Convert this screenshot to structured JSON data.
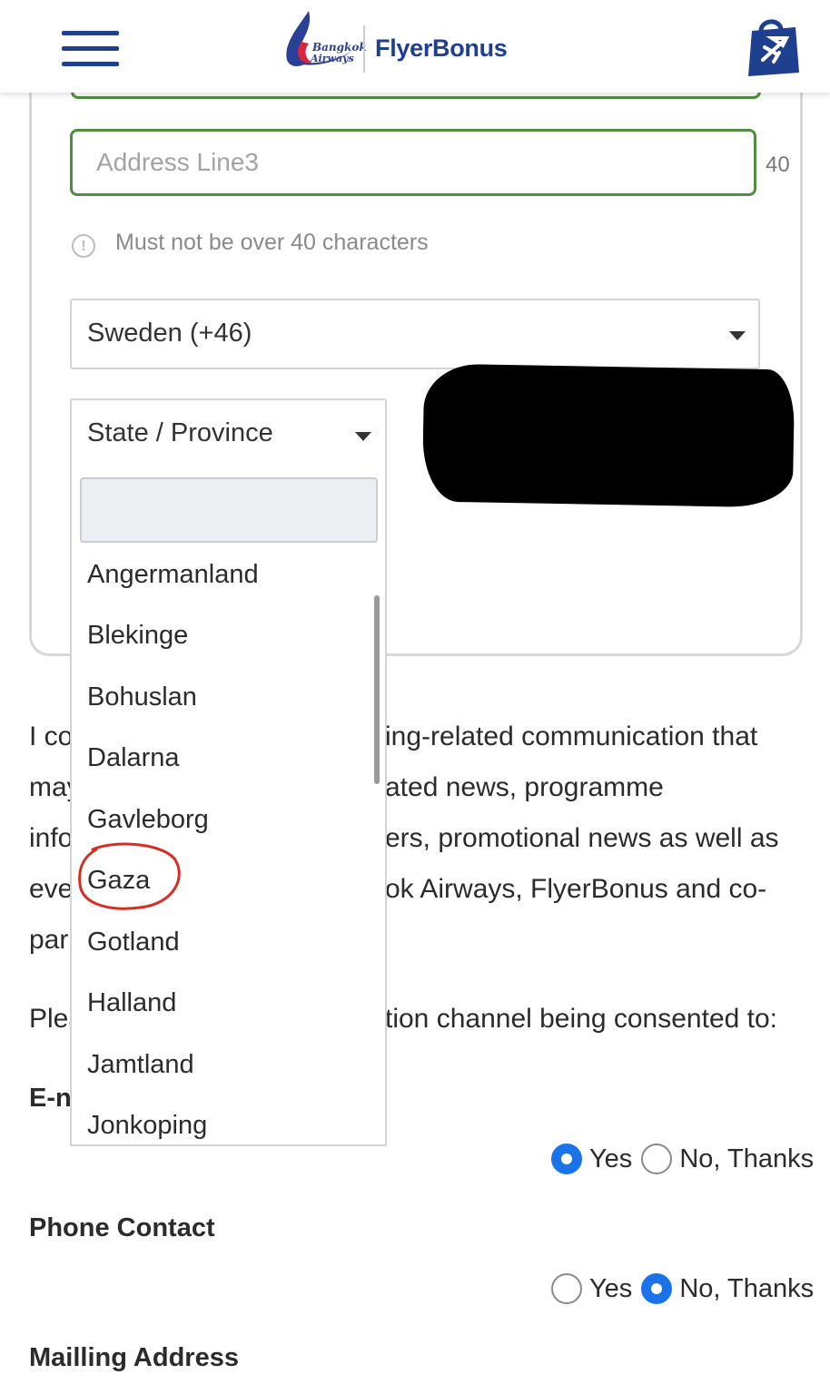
{
  "header": {
    "logo_small_1": "Bangkok",
    "logo_small_2": "Airways",
    "logo_brand": "FlyerBonus"
  },
  "form": {
    "address_line3_placeholder": "Address Line3",
    "address_line3_counter": "40",
    "hint": "Must not be over 40 characters",
    "country_value": "Sweden (+46)",
    "state_placeholder": "State / Province"
  },
  "dropdown": {
    "items": [
      "Angermanland",
      "Blekinge",
      "Bohuslan",
      "Dalarna",
      "Gavleborg",
      "Gaza",
      "Gotland",
      "Halland",
      "Jamtland",
      "Jonkoping"
    ],
    "highlighted_item": "Gaza",
    "highlight_color": "#d92b22"
  },
  "consent": {
    "lines": [
      {
        "left": "I co",
        "right": "ing-related communication that"
      },
      {
        "left": "may",
        "right": "ated news, programme"
      },
      {
        "left": "info",
        "right": "ers, promotional news as well as"
      },
      {
        "left": "eve",
        "right": "ok Airways, FlyerBonus and co-"
      },
      {
        "left": "par",
        "right": ""
      }
    ],
    "channel_line": {
      "left": "Plea",
      "right": "tion channel being consented to:"
    }
  },
  "channels": {
    "email_title": "E-n",
    "phone_title": "Phone Contact",
    "mailing_title": "Mailling Address",
    "yes_label": "Yes",
    "no_label": "No, Thanks",
    "email_selected": "Yes",
    "phone_selected": "No, Thanks"
  },
  "colors": {
    "brand_blue": "#1f3f8f",
    "field_green": "#4e8e3e",
    "radio_blue": "#1a73e8"
  }
}
